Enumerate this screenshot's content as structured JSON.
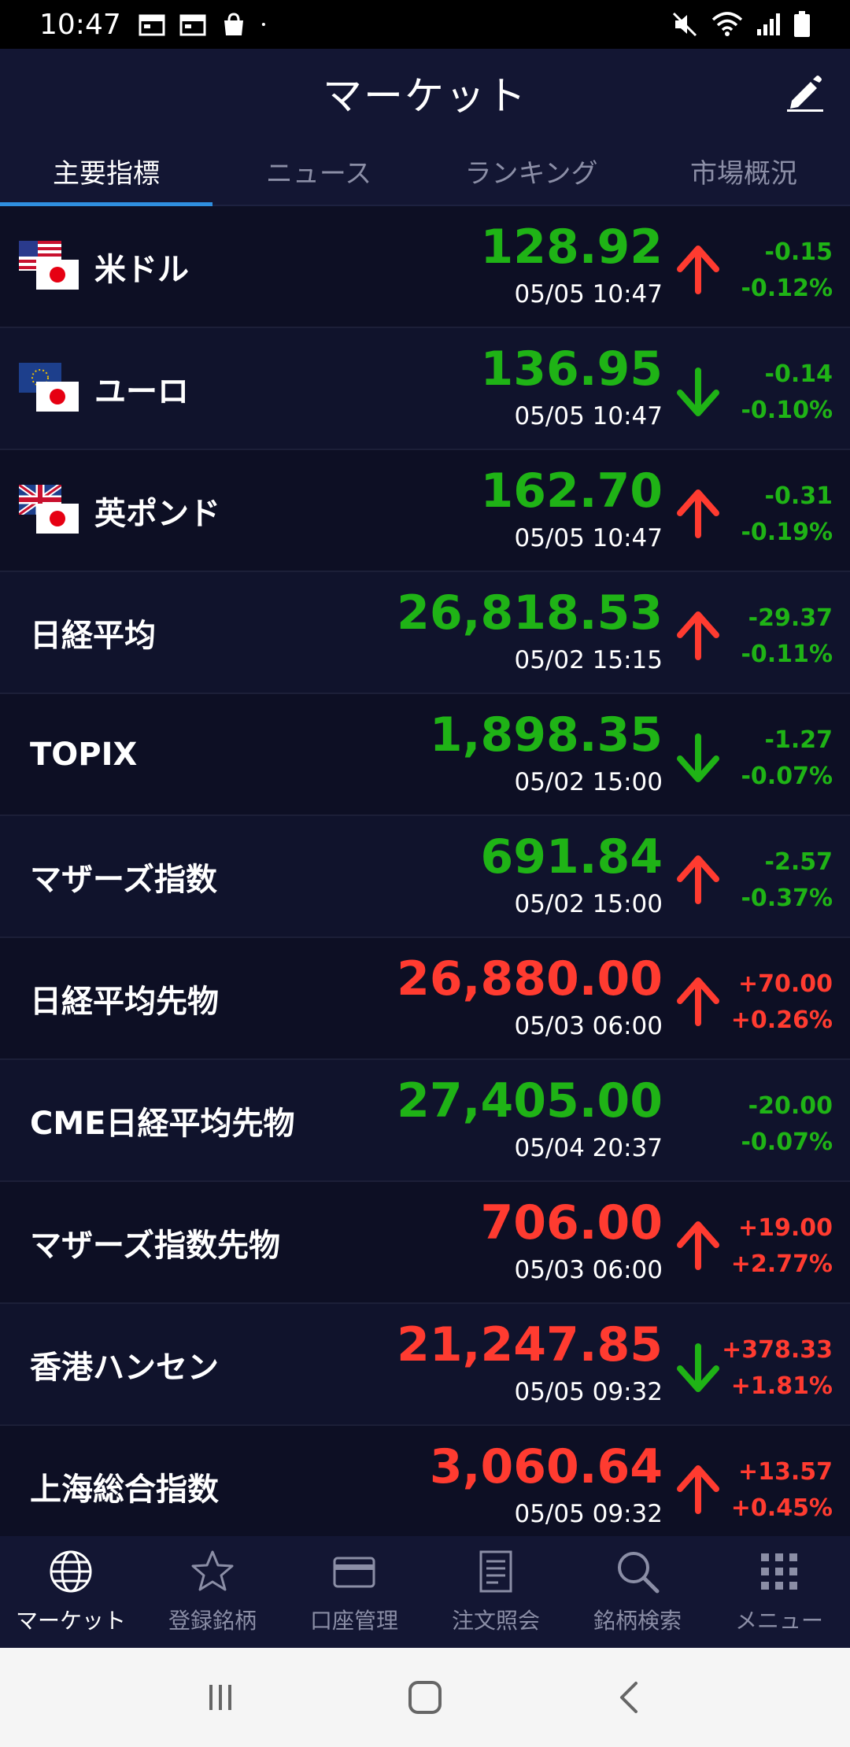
{
  "status_bar": {
    "time": "10:47"
  },
  "header": {
    "title": "マーケット"
  },
  "tabs": [
    {
      "label": "主要指標",
      "active": true
    },
    {
      "label": "ニュース",
      "active": false
    },
    {
      "label": "ランキング",
      "active": false
    },
    {
      "label": "市場概況",
      "active": false
    }
  ],
  "rows": [
    {
      "name": "米ドル",
      "price": "128.92",
      "time": "05/05 10:47",
      "arrow": "up",
      "change": "-0.15",
      "percent": "-0.12%",
      "price_color": "green",
      "change_color": "green",
      "flag": "us"
    },
    {
      "name": "ユーロ",
      "price": "136.95",
      "time": "05/05 10:47",
      "arrow": "down",
      "change": "-0.14",
      "percent": "-0.10%",
      "price_color": "green",
      "change_color": "green",
      "flag": "eu"
    },
    {
      "name": "英ポンド",
      "price": "162.70",
      "time": "05/05 10:47",
      "arrow": "up",
      "change": "-0.31",
      "percent": "-0.19%",
      "price_color": "green",
      "change_color": "green",
      "flag": "uk"
    },
    {
      "name": "日経平均",
      "price": "26,818.53",
      "time": "05/02 15:15",
      "arrow": "up",
      "change": "-29.37",
      "percent": "-0.11%",
      "price_color": "green",
      "change_color": "green"
    },
    {
      "name": "TOPIX",
      "price": "1,898.35",
      "time": "05/02 15:00",
      "arrow": "down",
      "change": "-1.27",
      "percent": "-0.07%",
      "price_color": "green",
      "change_color": "green"
    },
    {
      "name": "マザーズ指数",
      "price": "691.84",
      "time": "05/02 15:00",
      "arrow": "up",
      "change": "-2.57",
      "percent": "-0.37%",
      "price_color": "green",
      "change_color": "green"
    },
    {
      "name": "日経平均先物",
      "price": "26,880.00",
      "time": "05/03 06:00",
      "arrow": "up",
      "change": "+70.00",
      "percent": "+0.26%",
      "price_color": "red",
      "change_color": "red"
    },
    {
      "name": "CME日経平均先物",
      "price": "27,405.00",
      "time": "05/04 20:37",
      "arrow": "none",
      "change": "-20.00",
      "percent": "-0.07%",
      "price_color": "green",
      "change_color": "green"
    },
    {
      "name": "マザーズ指数先物",
      "price": "706.00",
      "time": "05/03 06:00",
      "arrow": "up",
      "change": "+19.00",
      "percent": "+2.77%",
      "price_color": "red",
      "change_color": "red"
    },
    {
      "name": "香港ハンセン",
      "price": "21,247.85",
      "time": "05/05 09:32",
      "arrow": "down",
      "change": "+378.33",
      "percent": "+1.81%",
      "price_color": "red",
      "change_color": "red"
    },
    {
      "name": "上海総合指数",
      "price": "3,060.64",
      "time": "05/05 09:32",
      "arrow": "up",
      "change": "+13.57",
      "percent": "+0.45%",
      "price_color": "red",
      "change_color": "red"
    }
  ],
  "bottom_nav": [
    {
      "label": "マーケット",
      "icon": "globe-icon",
      "active": true
    },
    {
      "label": "登録銘柄",
      "icon": "star-icon",
      "active": false
    },
    {
      "label": "口座管理",
      "icon": "card-icon",
      "active": false
    },
    {
      "label": "注文照会",
      "icon": "document-icon",
      "active": false
    },
    {
      "label": "銘柄検索",
      "icon": "search-icon",
      "active": false
    },
    {
      "label": "メニュー",
      "icon": "grid-icon",
      "active": false
    }
  ],
  "colors": {
    "green": "#1fb316",
    "red": "#ff3b30",
    "accent": "#2f8fe0",
    "background": "#0d0f24"
  }
}
